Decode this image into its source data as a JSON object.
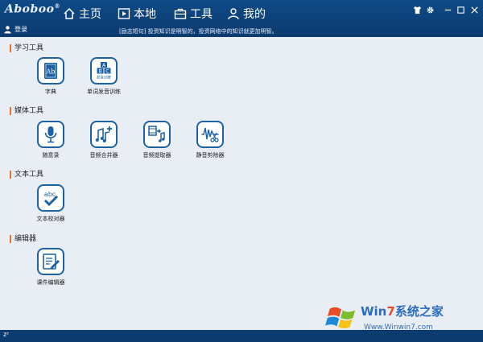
{
  "app": {
    "logo": "Aboboo",
    "logo_mark": "®"
  },
  "nav": [
    {
      "label": "主页",
      "icon": "home-icon"
    },
    {
      "label": "本地",
      "icon": "play-icon"
    },
    {
      "label": "工具",
      "icon": "toolbox-icon"
    },
    {
      "label": "我的",
      "icon": "user-icon"
    }
  ],
  "window_controls": [
    "shirt-icon",
    "gear-icon",
    "minimize-icon",
    "maximize-icon",
    "close-icon"
  ],
  "login_label": "登录",
  "quote": "[励志短句] 投资知识是明智的，投资网络中的知识就更加明智。",
  "sections": [
    {
      "title": "学习工具",
      "tools": [
        {
          "label": "字典",
          "icon": "dictionary-icon"
        },
        {
          "label": "单词发音训练",
          "icon": "abc-blocks-icon"
        }
      ]
    },
    {
      "title": "媒体工具",
      "tools": [
        {
          "label": "随意录",
          "icon": "microphone-icon"
        },
        {
          "label": "音频合并器",
          "icon": "music-merge-icon"
        },
        {
          "label": "音频提取器",
          "icon": "audio-extract-icon"
        },
        {
          "label": "静音剪除器",
          "icon": "waveform-cut-icon"
        }
      ]
    },
    {
      "title": "文本工具",
      "tools": [
        {
          "label": "文本校对器",
          "icon": "abc-check-icon"
        }
      ]
    },
    {
      "title": "编辑器",
      "tools": [
        {
          "label": "课件编辑器",
          "icon": "edit-document-icon"
        }
      ]
    }
  ],
  "dictionary_icon_text": "Ab",
  "abc_block_text": [
    "A",
    "B",
    "C"
  ],
  "abc_block_caption": "发音训练",
  "abc_check_text": "abc",
  "status_bar": {
    "sleep_label": "zᶻ"
  },
  "watermark": {
    "brand_prefix": "Win",
    "brand_digit": "7",
    "brand_suffix": "系统之家",
    "url": "Www.Winwin7.com"
  },
  "colors": {
    "topbar": "#0f4a86",
    "accent": "#e8732a",
    "icon_blue": "#1d62a5",
    "background": "#e9eef4"
  }
}
